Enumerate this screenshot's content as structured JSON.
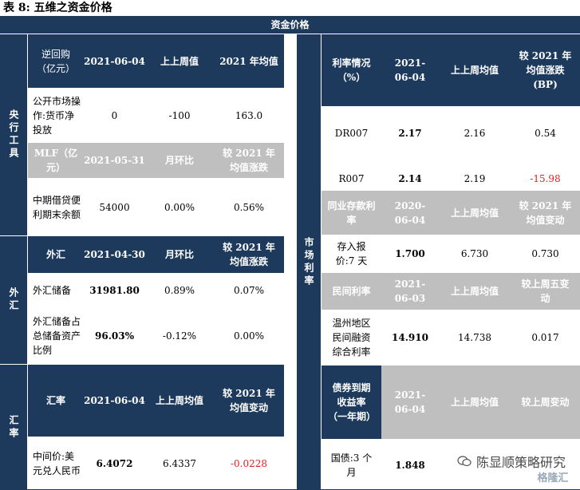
{
  "caption": "表 8: 五维之资金价格",
  "header": {
    "title": "资金价格"
  },
  "left": {
    "group1": "央行工具",
    "group2": "外汇",
    "group3": "汇率",
    "hdr1": [
      "逆回购（亿元）",
      "2021-06-04",
      "上上周值",
      "2021 年均值"
    ],
    "row1": [
      "公开市场操作:货币净投放",
      "0",
      "-100",
      "163.0"
    ],
    "hdr2": [
      "MLF（亿元）",
      "2021-05-31",
      "月环比",
      "较 2021 年均值涨跌"
    ],
    "row2": [
      "中期借贷便利期末余额",
      "54000",
      "0.00%",
      "0.56%"
    ],
    "hdr3": [
      "外汇",
      "2021-04-30",
      "月环比",
      "较 2021 年均值涨跌"
    ],
    "row3": [
      "外汇储备",
      "31981.80",
      "0.89%",
      "0.07%"
    ],
    "row4": [
      "外汇储备占总储备资产比例",
      "96.03%",
      "-0.12%",
      "0.00%"
    ],
    "hdr4": [
      "汇率",
      "2021-06-04",
      "上上周均值",
      "较 2021 年均值变动"
    ],
    "row5": [
      "中间价:美元兑人民币",
      "6.4072",
      "6.4337",
      "-0.0228"
    ]
  },
  "right": {
    "group1": "市场利率",
    "hdr1": [
      "利率情况（%）",
      "2021-06-04",
      "上上周均值",
      "较 2021 年均值涨跌 (BP)"
    ],
    "row1": [
      "DR007",
      "2.17",
      "2.16",
      "0.54"
    ],
    "row2": [
      "R007",
      "2.14",
      "2.19",
      "-15.98"
    ],
    "hdr2": [
      "同业存款利率",
      "2020-06-04",
      "上上周均值",
      "较 2021 年均值变动"
    ],
    "row3": [
      "存入报价:7 天",
      "1.700",
      "6.730",
      "0.730"
    ],
    "hdr3": [
      "民间利率",
      "2021-06-03",
      "上上周均值",
      "较上周五变动"
    ],
    "row4": [
      "温州地区民间融资综合利率",
      "14.910",
      "14.738",
      "0.017"
    ],
    "hdr4": [
      "债券到期收益率（一年期）",
      "2021-06-04",
      "上上周均值",
      "较上周变动"
    ],
    "row5": [
      "国债:3 个月",
      "1.848"
    ]
  },
  "watermark": {
    "text": "陈显顺策略研究",
    "badge": "格隆汇"
  },
  "colors": {
    "navy": "#1d3a5c",
    "grey": "#bfbfbf",
    "negative": "#e02020"
  }
}
